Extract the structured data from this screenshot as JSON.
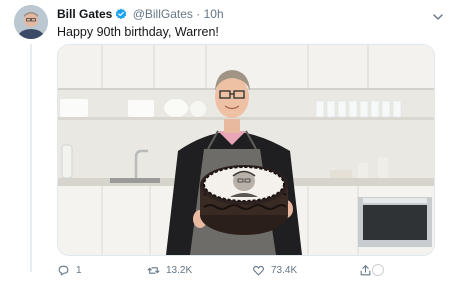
{
  "tweet": {
    "author_name": "Bill Gates",
    "handle": "@BillGates",
    "separator": "·",
    "time": "10h",
    "text": "Happy 90th birthday, Warren!",
    "replies": "1",
    "retweets": "13.2K",
    "likes": "73.4K"
  },
  "icons": {
    "verified": "verified-badge-icon",
    "menu": "chevron-down-icon",
    "reply": "reply-icon",
    "retweet": "retweet-icon",
    "like": "heart-icon",
    "share": "share-icon"
  },
  "colors": {
    "verified_blue": "#1da1f2",
    "secondary_text": "#657786",
    "primary_text": "#14171a"
  }
}
